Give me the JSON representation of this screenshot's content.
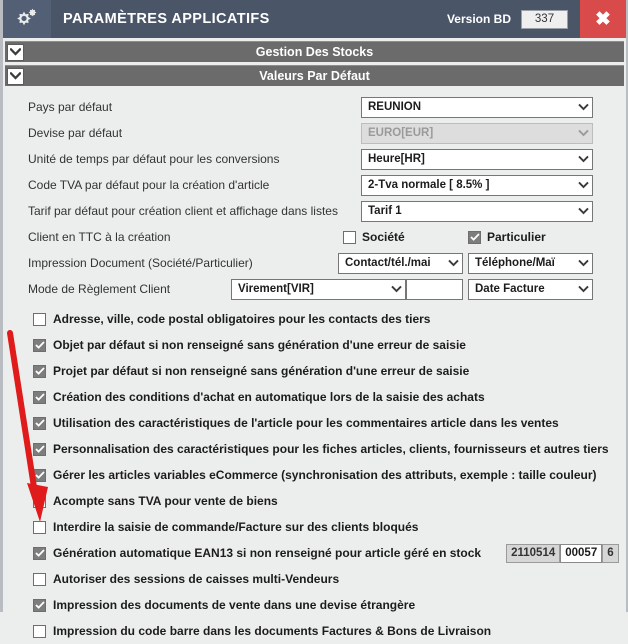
{
  "window": {
    "icon": "gears-icon",
    "title": "PARAMÈTRES APPLICATIFS",
    "version_label": "Version BD",
    "version_value": "337",
    "close_label": "✖",
    "accent_titlebar": "#4a5568",
    "accent_close": "#d94a4a",
    "accent_section": "#6b6b6b",
    "annotation_color": "#e01b1b"
  },
  "sections": [
    {
      "title": "Gestion Des Stocks",
      "toggle": "chevron-down-icon"
    },
    {
      "title": "Valeurs Par Défaut",
      "toggle": "chevron-down-icon"
    }
  ],
  "fields": [
    {
      "label": "Pays par défaut",
      "value": "RÉUNION",
      "disabled": false
    },
    {
      "label": "Devise par défaut",
      "value": "EURO[EUR]",
      "disabled": true
    },
    {
      "label": "Unité de temps par défaut pour les conversions",
      "value": "Heure[HR]",
      "disabled": false
    },
    {
      "label": "Code TVA par défaut pour la création d'article",
      "value": "2-Tva normale [ 8.5% ]",
      "disabled": false
    },
    {
      "label": "Tarif par défaut pour création client et affichage dans listes",
      "value": "Tarif 1",
      "disabled": false
    }
  ],
  "ttc_row": {
    "label": "Client en TTC à la création",
    "societe_label": "Société",
    "societe_checked": false,
    "particulier_label": "Particulier",
    "particulier_checked": true
  },
  "impression_row": {
    "label": "Impression Document (Société/Particulier)",
    "value_societe": "Contact/tél./mai",
    "value_particulier": "Téléphone/Maï"
  },
  "reglement_row": {
    "label": "Mode de Règlement Client",
    "value_mode": "Virement[VIR]",
    "value_blank": "",
    "value_condition": "Date Facture"
  },
  "options": [
    {
      "label": "Adresse, ville, code postal obligatoires pour les contacts des tiers",
      "checked": false
    },
    {
      "label": "Objet par défaut si non renseigné sans génération d'une erreur de saisie",
      "checked": true
    },
    {
      "label": "Projet par défaut si non renseigné sans génération d'une erreur de saisie",
      "checked": true
    },
    {
      "label": "Création des conditions d'achat en automatique lors de la saisie des achats",
      "checked": true
    },
    {
      "label": "Utilisation des caractéristiques de l'article pour les commentaires article dans les ventes",
      "checked": true
    },
    {
      "label": "Personnalisation des caractéristiques pour les fiches articles, clients, fournisseurs et autres tiers",
      "checked": true
    },
    {
      "label": "Gérer les articles variables eCommerce (synchronisation des attributs, exemple : taille couleur)",
      "checked": true
    },
    {
      "label": "Acompte sans TVA pour vente de biens",
      "checked": false
    },
    {
      "label": "Interdire la saisie de commande/Facture sur des clients bloqués",
      "checked": false
    }
  ],
  "ean_row": {
    "label": "Génération automatique EAN13 si non renseigné pour article géré en stock",
    "checked": true,
    "prefix": "2110514",
    "sequence": "00057",
    "key": "6"
  },
  "options_tail": [
    {
      "label": "Autoriser des sessions de caisses multi-Vendeurs",
      "checked": false
    },
    {
      "label": "Impression des documents de vente dans une devise étrangère",
      "checked": true
    },
    {
      "label": "Impression du code barre dans les documents Factures & Bons de Livraison",
      "checked": false
    }
  ]
}
